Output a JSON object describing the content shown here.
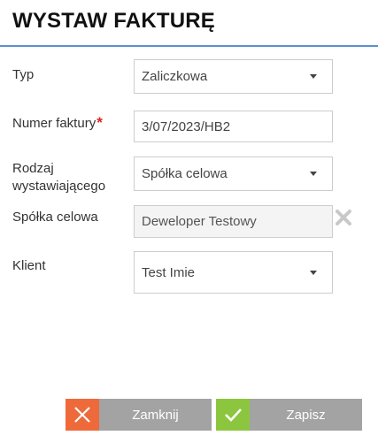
{
  "dialog": {
    "title": "WYSTAW FAKTURĘ"
  },
  "form": {
    "type": {
      "label": "Typ",
      "value": "Zaliczkowa"
    },
    "invoice_number": {
      "label": "Numer faktury",
      "required_mark": "*",
      "value": "3/07/2023/HB2"
    },
    "issuer_kind": {
      "label_line1": "Rodzaj",
      "label_line2": "wystawiającego",
      "value": "Spółka celowa"
    },
    "special_company": {
      "label": "Spółka celowa",
      "value": "Deweloper Testowy"
    },
    "client": {
      "label": "Klient",
      "value": "Test Imie"
    }
  },
  "actions": {
    "close_label": "Zamknij",
    "save_label": "Zapisz"
  },
  "icons": {
    "dropdown": "chevron-down-icon",
    "clear": "close-icon",
    "close_button": "close-icon",
    "save_button": "check-icon"
  },
  "colors": {
    "title_rule": "#5b8fd1",
    "required": "#e02020",
    "close_accent": "#ee6a3a",
    "save_accent": "#8cc63f",
    "button_body": "#a3a3a3"
  }
}
